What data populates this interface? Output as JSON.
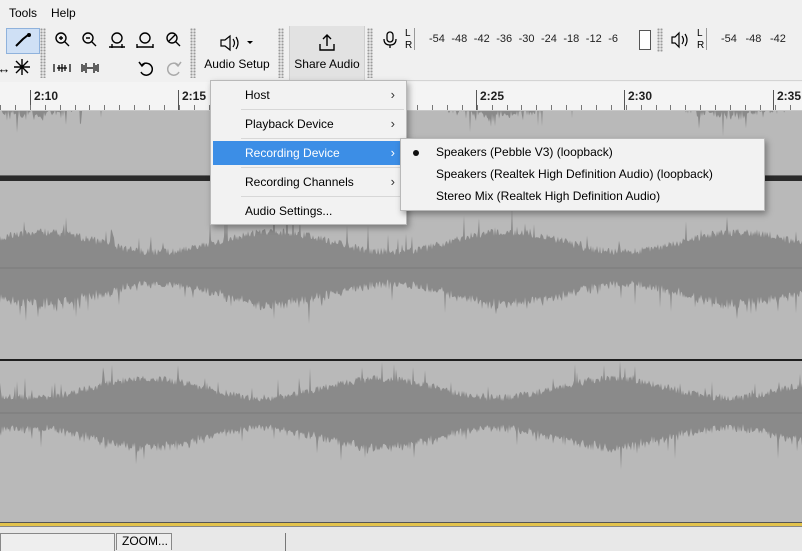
{
  "menubar": {
    "items": [
      "Tools",
      "Help"
    ]
  },
  "toolbar": {
    "audio_setup_label": "Audio Setup",
    "share_audio_label": "Share Audio",
    "meter_scale": [
      "-54",
      "-48",
      "-42",
      "-36",
      "-30",
      "-24",
      "-18",
      "-12",
      "-6"
    ],
    "meter_scale_right": [
      "-54",
      "-48",
      "-42"
    ],
    "meter_lr": [
      "L",
      "R"
    ]
  },
  "ruler": {
    "labels": [
      "2:10",
      "2:15",
      "2:25",
      "2:30",
      "2:35"
    ]
  },
  "audio_setup_menu": {
    "items": [
      {
        "label": "Host",
        "submenu": true
      },
      {
        "label": "Playback Device",
        "submenu": true
      },
      {
        "label": "Recording Device",
        "submenu": true,
        "highlighted": true
      },
      {
        "label": "Recording Channels",
        "submenu": true
      },
      {
        "label": "Audio Settings...",
        "submenu": false
      }
    ]
  },
  "recording_device_submenu": {
    "items": [
      {
        "label": "Speakers (Pebble V3) (loopback)",
        "selected": true
      },
      {
        "label": "Speakers (Realtek High Definition Audio) (loopback)",
        "selected": false
      },
      {
        "label": "Stereo Mix (Realtek High Definition Audio)",
        "selected": false
      }
    ]
  },
  "bottom_bar": {
    "zoom_label": "ZOOM..."
  },
  "colors": {
    "menu_highlight": "#3c8ee6",
    "waveform": "#8a8a8a",
    "track_background": "#b9b9b9"
  }
}
